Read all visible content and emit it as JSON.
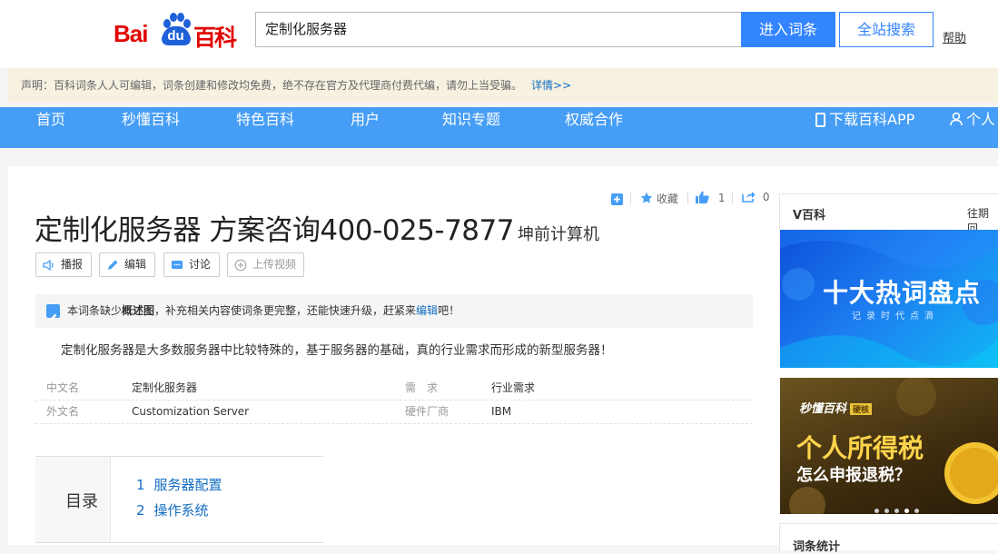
{
  "header": {
    "logo_text_1": "Bai",
    "logo_text_2": "du",
    "logo_text_3": "百科",
    "search_value": "定制化服务器",
    "enter_button": "进入词条",
    "site_search_button": "全站搜索",
    "help_link": "帮助"
  },
  "notice": {
    "text": "声明：百科词条人人可编辑，词条创建和修改均免费，绝不存在官方及代理商付费代编，请勿上当受骗。",
    "more_link": "详情>>"
  },
  "nav": {
    "items": [
      "首页",
      "秒懂百科",
      "特色百科",
      "用户",
      "知识专题",
      "权威合作"
    ],
    "app_link": "下载百科APP",
    "user_link": "个人"
  },
  "actions": {
    "favorite": "收藏",
    "like_count": "1",
    "share_count": "0"
  },
  "entry": {
    "title": "定制化服务器 方案咨询400-025-7877",
    "subtitle": "坤前计算机",
    "tools": [
      "播报",
      "编辑",
      "讨论",
      "上传视频"
    ],
    "tip_prefix": "本词条缺少",
    "tip_bold": "概述图",
    "tip_middle": "，补充相关内容使词条更完整，还能快速升级，赶紧来",
    "tip_link": "编辑",
    "tip_suffix": "吧！",
    "summary": "定制化服务器是大多数服务器中比较特殊的，基于服务器的基础，真的行业需求而形成的新型服务器！",
    "basic_info": [
      {
        "k1": "中文名",
        "v1": "定制化服务器",
        "k2": "需　求",
        "v2": "行业需求"
      },
      {
        "k1": "外文名",
        "v1": "Customization Server",
        "k2": "硬件厂商",
        "v2": "IBM"
      }
    ],
    "toc_label": "目录",
    "toc": [
      {
        "num": "1",
        "text": "服务器配置"
      },
      {
        "num": "2",
        "text": "操作系统"
      }
    ]
  },
  "sidebar": {
    "title": "V百科",
    "more": "往期回",
    "banner1_title": "十大热词盘点",
    "banner1_sub": "记录时代点滴",
    "banner2_brand": "秒懂百科",
    "banner2_tag": "硬核",
    "banner2_title": "个人所得税",
    "banner2_sub": "怎么申报退税？",
    "footer_title": "词条统计"
  },
  "colors": {
    "brand_red": "#e10602",
    "brand_blue": "#3385ff",
    "nav_blue": "#459df5",
    "link_blue": "#136ec2"
  }
}
